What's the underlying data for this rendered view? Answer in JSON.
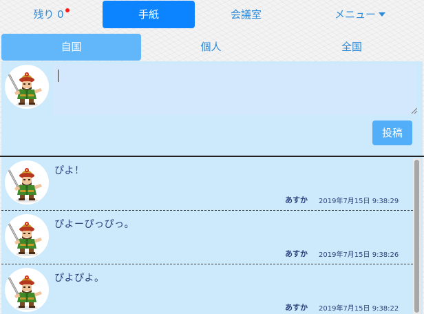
{
  "topnav": {
    "remaining_label": "残り 0",
    "letter_label": "手紙",
    "meeting_label": "会議室",
    "menu_label": "メニュー"
  },
  "subtabs": {
    "own_country": "自国",
    "personal": "個人",
    "nationwide": "全国"
  },
  "compose": {
    "input_value": "",
    "post_label": "投稿"
  },
  "messages": [
    {
      "text": "ぴよ！",
      "author": "あすか",
      "time": "2019年7月15日 9:38:29"
    },
    {
      "text": "ぴよーぴっぴっ。",
      "author": "あすか",
      "time": "2019年7月15日 9:38:26"
    },
    {
      "text": "ぴよぴよ。",
      "author": "あすか",
      "time": "2019年7月15日 9:38:22"
    }
  ],
  "colors": {
    "accent": "#0d84ff",
    "subtab_active": "#62b7fb",
    "panel_bg": "#cdeafc",
    "text_blue": "#2d8ad8",
    "notice_red": "#ff1a1a"
  }
}
